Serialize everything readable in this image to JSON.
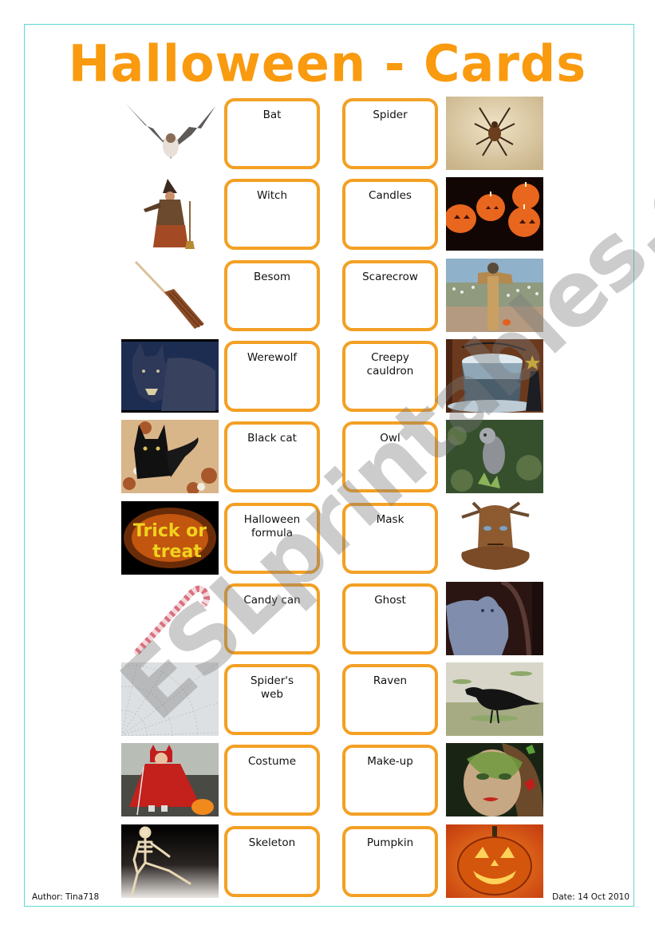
{
  "title": "Halloween - Cards",
  "accent_color": "#f99a0f",
  "card_border_color": "#f3a024",
  "frame_color": "#5fd9d3",
  "rows": [
    {
      "left": {
        "label": "Bat",
        "picture": "bat-picture"
      },
      "right": {
        "label": "Spider",
        "picture": "spider-picture"
      }
    },
    {
      "left": {
        "label": "Witch",
        "picture": "witch-picture"
      },
      "right": {
        "label": "Candles",
        "picture": "pumpkin-candles-picture"
      }
    },
    {
      "left": {
        "label": "Besom",
        "picture": "broom-picture"
      },
      "right": {
        "label": "Scarecrow",
        "picture": "scarecrow-picture"
      }
    },
    {
      "left": {
        "label": "Werewolf",
        "picture": "werewolf-picture"
      },
      "right": {
        "label": "Creepy cauldron",
        "picture": "cauldron-picture"
      }
    },
    {
      "left": {
        "label": "Black cat",
        "picture": "black-cat-picture"
      },
      "right": {
        "label": "Owl",
        "picture": "owl-picture"
      }
    },
    {
      "left": {
        "label": "Halloween formula",
        "picture": "trick-or-treat-picture"
      },
      "right": {
        "label": "Mask",
        "picture": "tree-mask-picture"
      }
    },
    {
      "left": {
        "label": "Candy can",
        "picture": "candy-cane-picture"
      },
      "right": {
        "label": "Ghost",
        "picture": "ghost-picture"
      }
    },
    {
      "left": {
        "label": "Spider's web",
        "picture": "spider-web-picture"
      },
      "right": {
        "label": "Raven",
        "picture": "raven-picture"
      }
    },
    {
      "left": {
        "label": "Costume",
        "picture": "devil-costume-picture"
      },
      "right": {
        "label": "Make-up",
        "picture": "makeup-face-picture"
      }
    },
    {
      "left": {
        "label": "Skeleton",
        "picture": "skeleton-picture"
      },
      "right": {
        "label": "Pumpkin",
        "picture": "jack-o-lantern-picture"
      }
    }
  ],
  "picture_texts": {
    "trick_or_treat_line1": "Trick or",
    "trick_or_treat_line2": "treat"
  },
  "footer": {
    "author": "Author: Tina718",
    "date": "Date: 14 Oct 2010"
  },
  "watermark": "ESLprintables.com"
}
